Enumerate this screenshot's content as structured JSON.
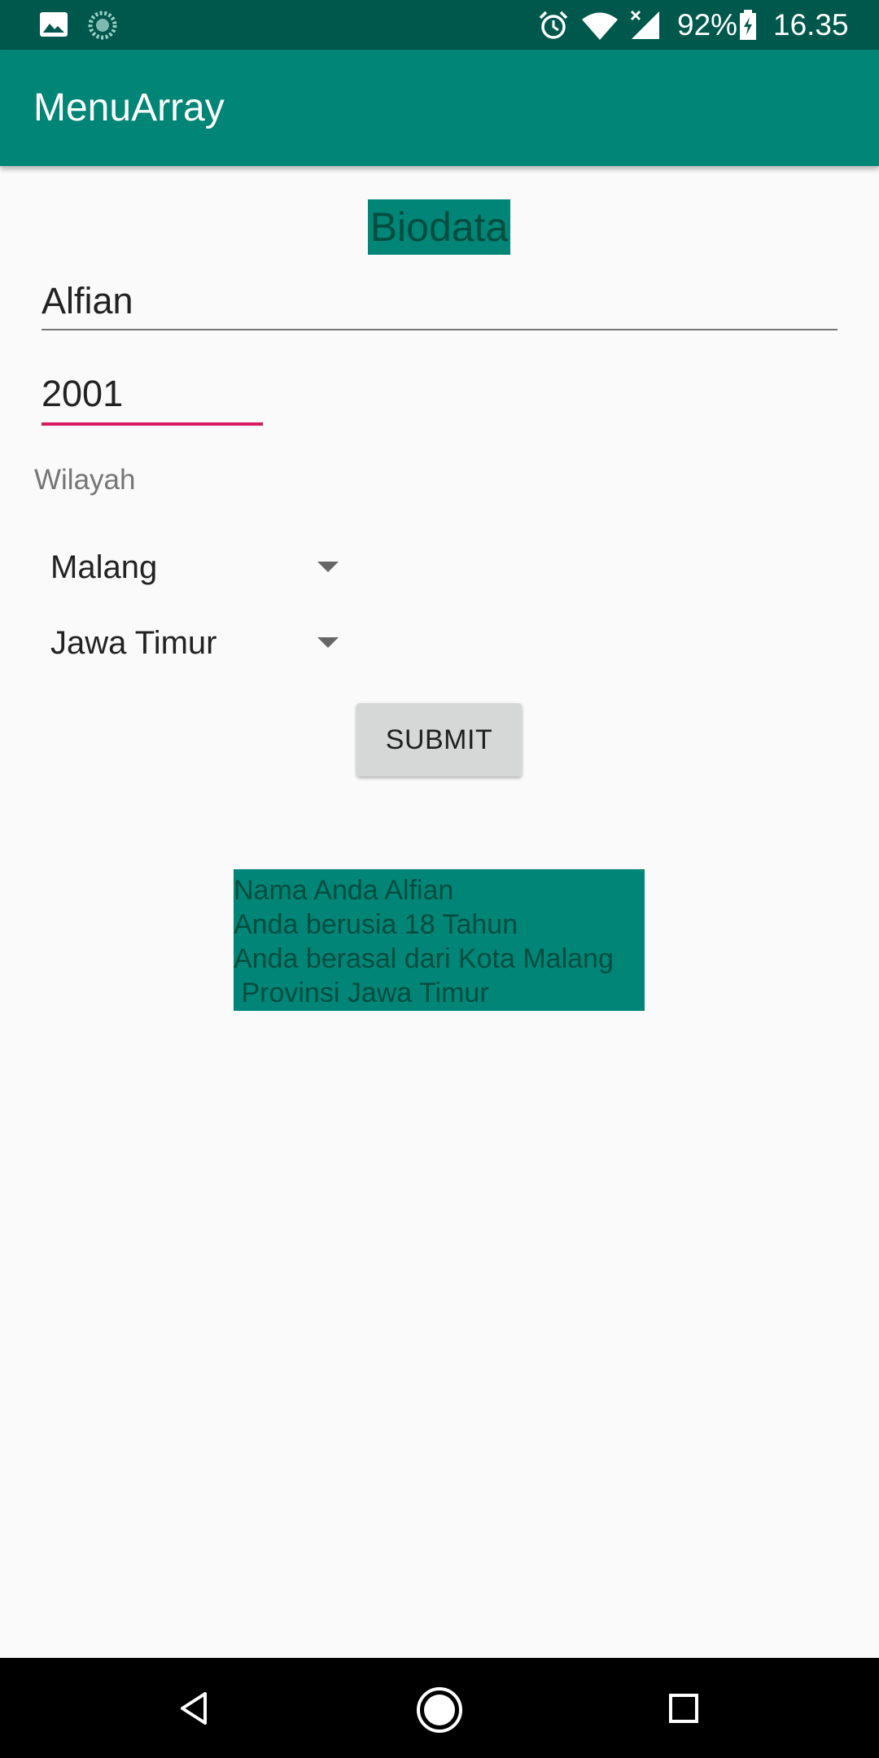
{
  "status_bar": {
    "left_icons": [
      "image-icon",
      "loading-icon"
    ],
    "right_icons": [
      "alarm-icon",
      "wifi-icon",
      "signal-icon",
      "battery-icon"
    ],
    "battery_percent": "92%",
    "time": "16.35"
  },
  "app_bar": {
    "title": "MenuArray"
  },
  "form": {
    "heading": "Biodata",
    "name_value": "Alfian",
    "year_value": "2001",
    "region_label": "Wilayah",
    "city_selected": "Malang",
    "province_selected": "Jawa Timur",
    "submit_label": "SUBMIT"
  },
  "result": {
    "lines": [
      "Nama Anda Alfian",
      "Anda berusia 18 Tahun",
      "Anda berasal dari Kota Malang",
      " Provinsi Jawa Timur"
    ]
  },
  "nav_bar": {
    "buttons": [
      "back-icon",
      "home-icon",
      "recents-icon"
    ]
  },
  "colors": {
    "primary": "#008577",
    "primary_dark": "#00574b",
    "accent": "#D81B60",
    "background": "#fafafa"
  }
}
